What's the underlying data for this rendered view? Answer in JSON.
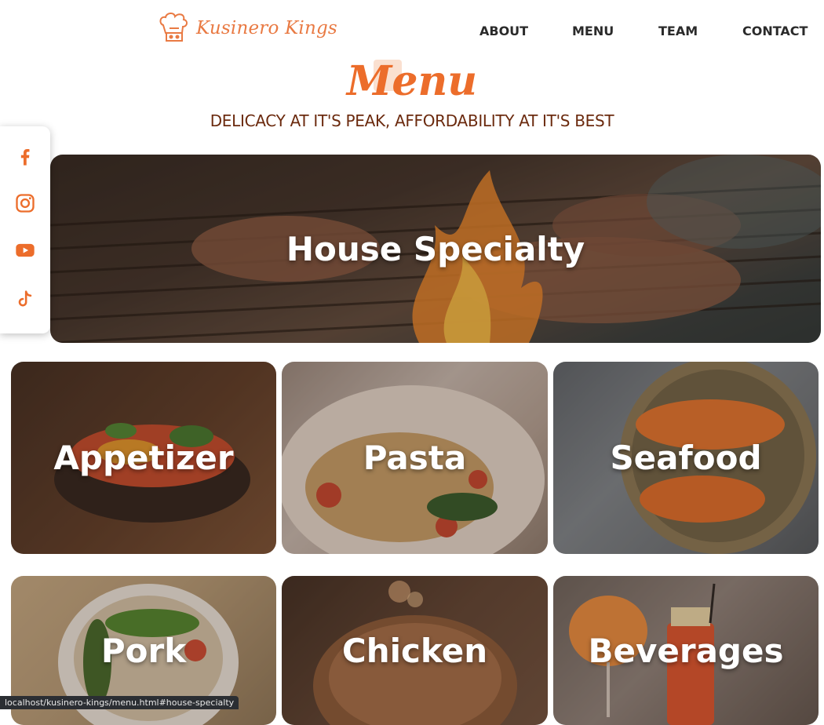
{
  "brand": {
    "name": "Kusinero Kings",
    "accent": "#ec6d2b"
  },
  "nav": {
    "items": [
      "ABOUT",
      "MENU",
      "TEAM",
      "CONTACT"
    ]
  },
  "page": {
    "title": "Menu",
    "subtitle": "DELICACY AT IT'S PEAK, AFFORDABILITY AT IT'S BEST"
  },
  "social": {
    "icons": [
      "facebook-icon",
      "instagram-icon",
      "youtube-icon",
      "tiktok-icon"
    ],
    "color": "#ec6d2b"
  },
  "categories": {
    "featured": "House Specialty",
    "items": [
      "Appetizer",
      "Pasta",
      "Seafood",
      "Pork",
      "Chicken",
      "Beverages"
    ]
  },
  "status": {
    "url": "localhost/kusinero-kings/menu.html#house-specialty"
  }
}
